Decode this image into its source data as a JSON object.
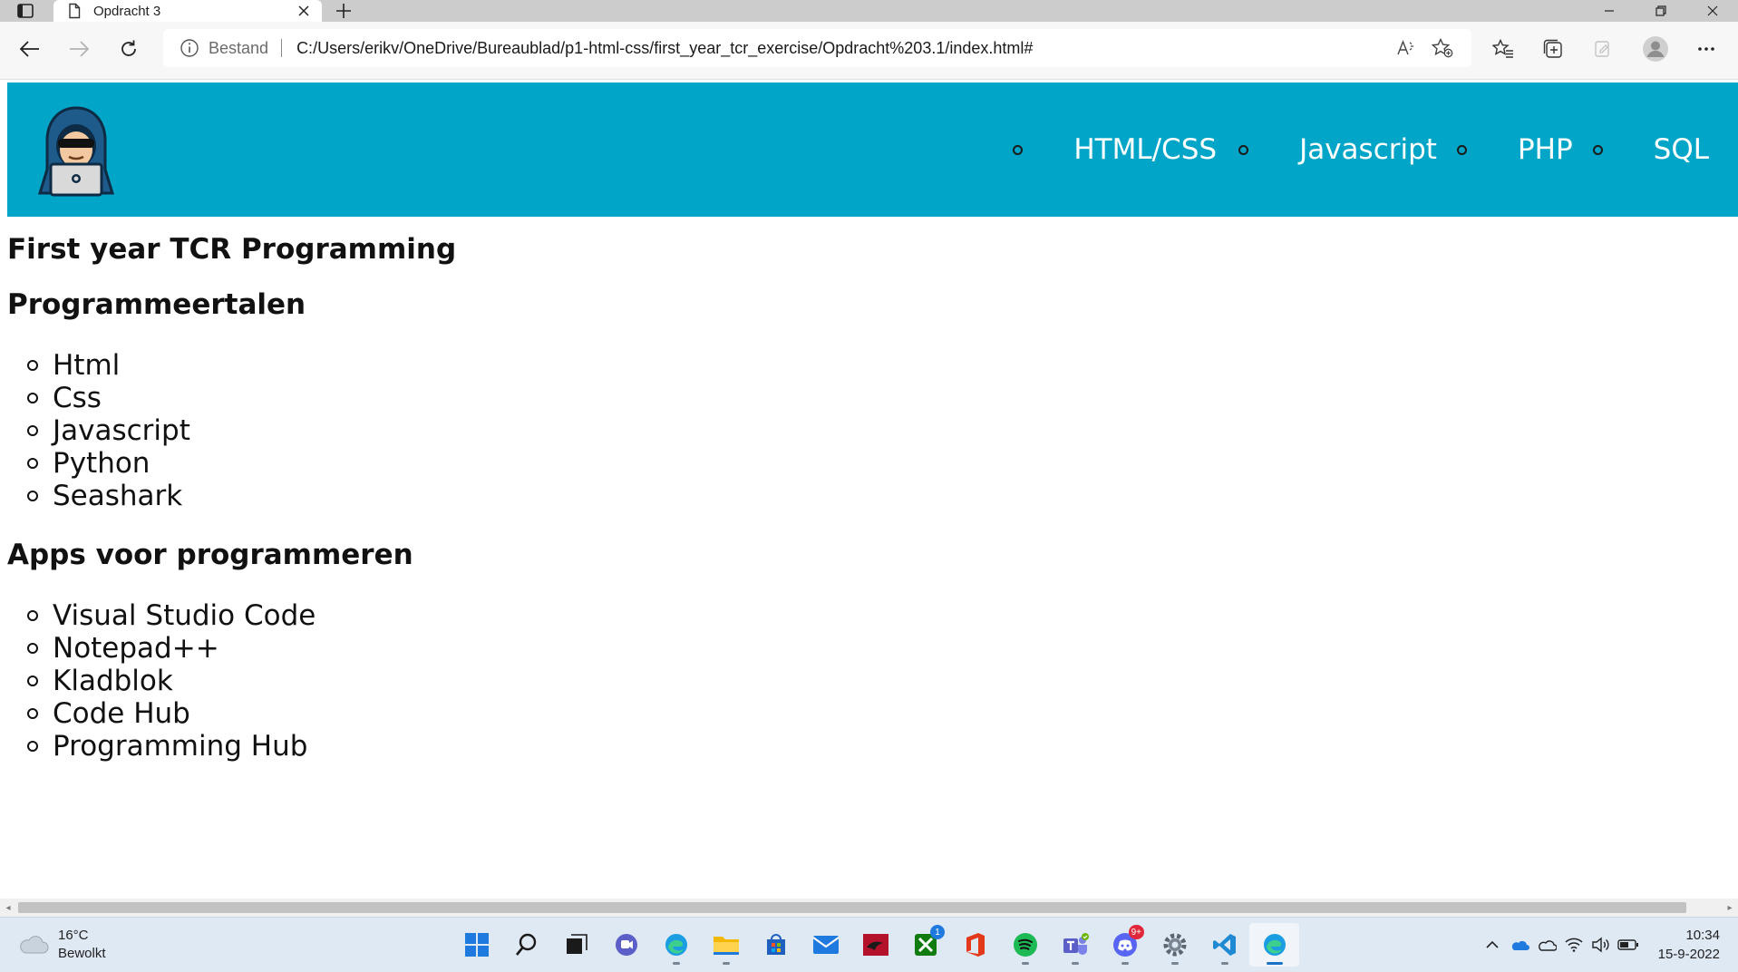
{
  "browser": {
    "tab": {
      "title": "Opdracht 3"
    },
    "address": {
      "site_label": "Bestand",
      "url": "C:/Users/erikv/OneDrive/Bureaublad/p1-html-css/first_year_tcr_exercise/Opdracht%203.1/index.html#"
    }
  },
  "site": {
    "nav": [
      "HTML/CSS",
      "Javascript",
      "PHP",
      "SQL"
    ],
    "title": "First year TCR Programming",
    "section1": {
      "heading": "Programmeertalen",
      "items": [
        "Html",
        "Css",
        "Javascript",
        "Python",
        "Seashark"
      ]
    },
    "section2": {
      "heading": "Apps voor programmeren",
      "items": [
        "Visual Studio Code",
        "Notepad++",
        "Kladblok",
        "Code Hub",
        "Programming Hub"
      ]
    }
  },
  "taskbar": {
    "weather": {
      "temp": "16°C",
      "condition": "Bewolkt"
    },
    "apps": [
      {
        "icon": "windows-start-icon"
      },
      {
        "icon": "search-icon"
      },
      {
        "icon": "task-view-icon"
      },
      {
        "icon": "chat-icon"
      },
      {
        "icon": "edge-icon"
      },
      {
        "icon": "file-explorer-icon"
      },
      {
        "icon": "store-icon"
      },
      {
        "icon": "mail-icon"
      },
      {
        "icon": "app-red-icon"
      },
      {
        "icon": "xbox-icon",
        "badge": "1"
      },
      {
        "icon": "office-icon"
      },
      {
        "icon": "spotify-icon"
      },
      {
        "icon": "teams-icon"
      },
      {
        "icon": "discord-icon",
        "badge": "9+"
      },
      {
        "icon": "settings-icon"
      },
      {
        "icon": "vscode-icon"
      },
      {
        "icon": "edge-active-icon"
      }
    ],
    "clock": {
      "time": "10:34",
      "date": "15-9-2022"
    }
  },
  "colors": {
    "header_bg": "#00a5c7",
    "nav_text": "#ffffff"
  }
}
